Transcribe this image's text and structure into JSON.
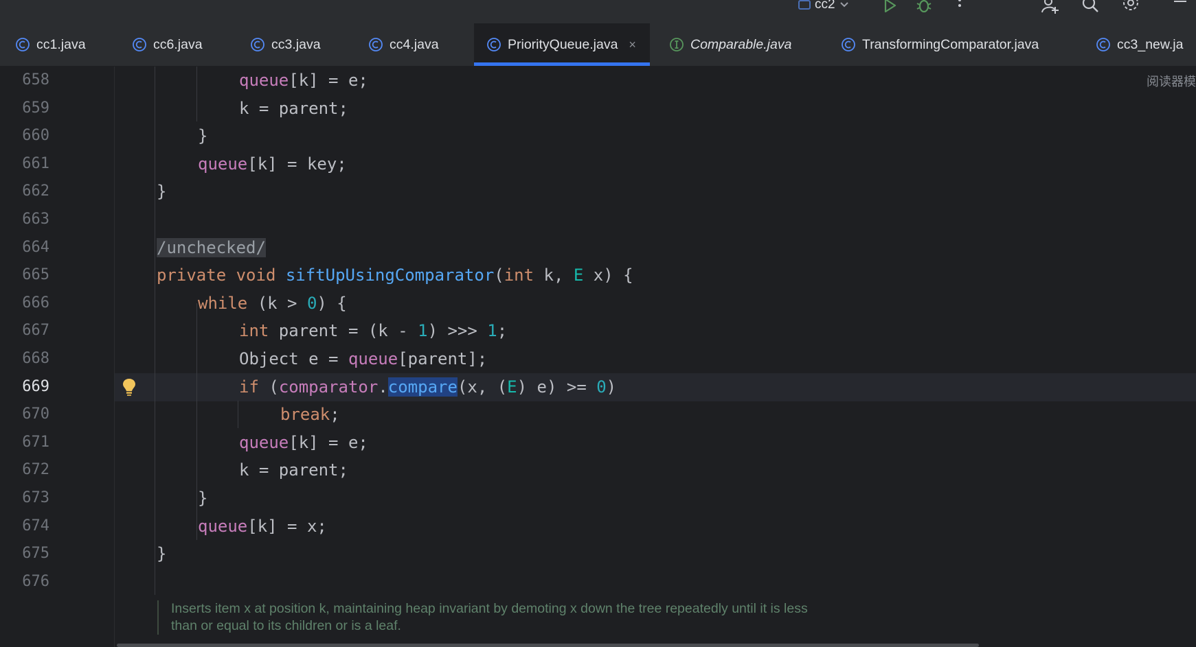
{
  "toolbar": {
    "run_config_label": "cc2",
    "icons": [
      "run-icon",
      "debug-icon",
      "more-icon",
      "add-user-icon",
      "search-icon",
      "settings-icon",
      "minimize-icon"
    ]
  },
  "tabs": [
    {
      "label": "cc1.java",
      "icon": "class-icon",
      "active": false,
      "italic": false
    },
    {
      "label": "cc6.java",
      "icon": "class-icon",
      "active": false,
      "italic": false
    },
    {
      "label": "cc3.java",
      "icon": "class-icon",
      "active": false,
      "italic": false
    },
    {
      "label": "cc4.java",
      "icon": "class-icon",
      "active": false,
      "italic": false
    },
    {
      "label": "PriorityQueue.java",
      "icon": "class-icon",
      "active": true,
      "italic": false,
      "close": "×"
    },
    {
      "label": "Comparable.java",
      "icon": "interface-icon",
      "active": false,
      "italic": true
    },
    {
      "label": "TransformingComparator.java",
      "icon": "class-icon",
      "active": false,
      "italic": false
    },
    {
      "label": "cc3_new.ja",
      "icon": "class-icon",
      "active": false,
      "italic": false
    }
  ],
  "editor": {
    "reader_mode_label": "阅读器模",
    "current_line": "669",
    "line_numbers": [
      "658",
      "659",
      "660",
      "661",
      "662",
      "663",
      "664",
      "665",
      "666",
      "667",
      "668",
      "669",
      "670",
      "671",
      "672",
      "673",
      "674",
      "675",
      "676"
    ],
    "code_lines": [
      {
        "ln": "658",
        "code": "queue[k] = e;"
      },
      {
        "ln": "659",
        "code": "k = parent;"
      },
      {
        "ln": "660",
        "code": "}"
      },
      {
        "ln": "661",
        "code": "queue[k] = key;"
      },
      {
        "ln": "662",
        "code": "}"
      },
      {
        "ln": "663",
        "code": ""
      },
      {
        "ln": "664",
        "code": "/unchecked/"
      },
      {
        "ln": "665",
        "code": "private void siftUpUsingComparator(int k, E x) {"
      },
      {
        "ln": "666",
        "code": "while (k > 0) {"
      },
      {
        "ln": "667",
        "code": "int parent = (k - 1) >>> 1;"
      },
      {
        "ln": "668",
        "code": "Object e = queue[parent];"
      },
      {
        "ln": "669",
        "code": "if (comparator.compare(x, (E) e) >= 0)"
      },
      {
        "ln": "670",
        "code": "break;"
      },
      {
        "ln": "671",
        "code": "queue[k] = e;"
      },
      {
        "ln": "672",
        "code": "k = parent;"
      },
      {
        "ln": "673",
        "code": "}"
      },
      {
        "ln": "674",
        "code": "queue[k] = x;"
      },
      {
        "ln": "675",
        "code": "}"
      },
      {
        "ln": "676",
        "code": ""
      }
    ],
    "selected_token": "compare",
    "intention_icon": "lightbulb-icon",
    "doc_comment": "Inserts item x at position k, maintaining heap invariant by demoting x down the tree repeatedly until it is less than or equal to its children or is a leaf."
  },
  "colors": {
    "keyword": "#cf8e6d",
    "field": "#c77dbb",
    "method": "#56a8f5",
    "number": "#2aacb8",
    "type_param": "#16baac",
    "selection": "#214283",
    "tab_underline": "#3574f0"
  }
}
